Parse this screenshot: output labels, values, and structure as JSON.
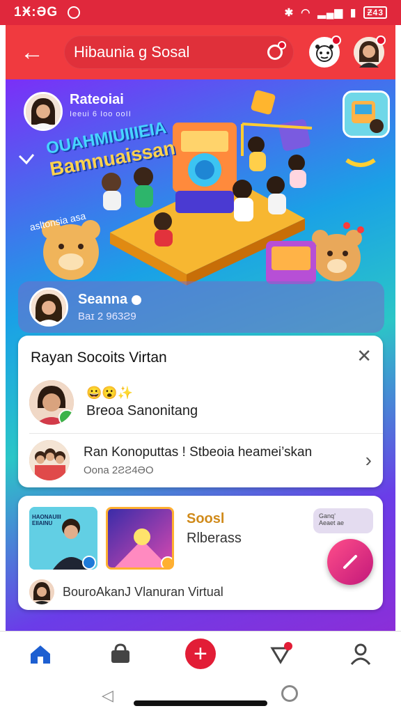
{
  "status_bar": {
    "time": "1Ӿ:ƏG",
    "battery": "Ƶ43"
  },
  "app_bar": {
    "search_text": "Hibaunia g Sosal"
  },
  "banner": {
    "profile_name": "Rateoiai",
    "profile_sub": "Ieeui 6 Ioo ooII",
    "title_line1": "OUAHMIUIIIEIA",
    "title_line2": "Bamnuaissan",
    "side_text": "asltonsia asa"
  },
  "profile_strip": {
    "name": "Seanna",
    "sub": "Baɪ 2 963Ƨ9"
  },
  "suggestions_card": {
    "title": "Rayan Socoits Virtan",
    "rows": [
      {
        "title": "Breoa Sanonitang",
        "sub": ""
      },
      {
        "title": "Ran  Konoputtas ! Stbeoia heamei’skan",
        "sub": "Oona 2ƧƧ4ƏO"
      }
    ]
  },
  "feed_card": {
    "title": "Soosl",
    "subtitle": "Rlberass",
    "caption": "BouroAkanJ Vlanuran Virtual",
    "chip_text1": "Ganq’",
    "chip_text2": "Aeaet ae",
    "thumb_title": "HAONAUIII EIIAINU"
  },
  "nav": [
    "home",
    "shop",
    "create",
    "notifications",
    "profile"
  ],
  "colors": {
    "accent": "#f03a3f",
    "status": "#e0283c",
    "fab": "#d12c80",
    "nav_active": "#1d5fd1"
  }
}
